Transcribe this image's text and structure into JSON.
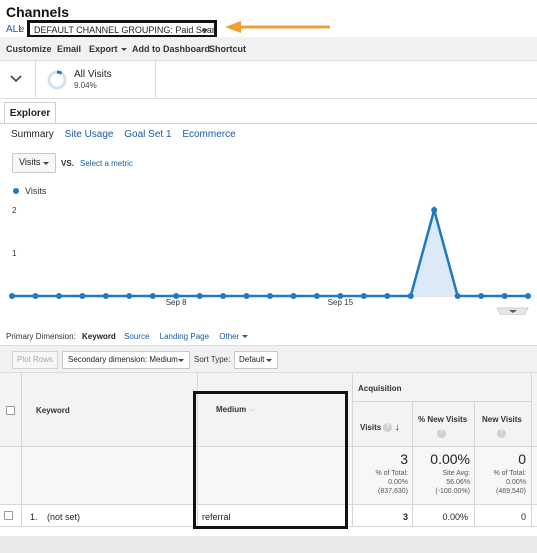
{
  "page": {
    "title": "Channels",
    "breadcrumb_all": "ALL",
    "breadcrumb_sep": "»",
    "grouping_label": "DEFAULT CHANNEL GROUPING: Paid Search"
  },
  "toolbar": {
    "customize": "Customize",
    "email": "Email",
    "export": "Export",
    "add_to_dashboard": "Add to Dashboard",
    "shortcut": "Shortcut"
  },
  "segment": {
    "name": "All Visits",
    "percent": "9.04%"
  },
  "tabs": {
    "explorer": "Explorer",
    "subtabs": [
      "Summary",
      "Site Usage",
      "Goal Set 1",
      "Ecommerce"
    ]
  },
  "metric": {
    "selected": "Visits",
    "vs": "VS.",
    "select_metric": "Select a metric"
  },
  "chart_data": {
    "type": "line",
    "series": [
      {
        "name": "Visits",
        "values": [
          0,
          0,
          0,
          0,
          0,
          0,
          0,
          0,
          0,
          0,
          0,
          0,
          0,
          0,
          0,
          0,
          0,
          0,
          2,
          0,
          0,
          0,
          0
        ]
      }
    ],
    "x_tick_labels": [
      "Sep 8",
      "Sep 15"
    ],
    "x_tick_index": [
      7,
      14
    ],
    "y_tick_labels": [
      "1",
      "2"
    ],
    "ylim": [
      0,
      2
    ],
    "color": "#1f78c1",
    "fill": "#dbeaf6",
    "legend": "top-left",
    "grid": false
  },
  "dimension": {
    "label": "Primary Dimension:",
    "current": "Keyword",
    "options": [
      "Source",
      "Landing Page",
      "Other"
    ]
  },
  "table_toolbar": {
    "plot_rows": "Plot Rows",
    "secondary": "Secondary dimension: Medium",
    "sort_label": "Sort Type:",
    "sort_value": "Default"
  },
  "table": {
    "group_header": "Acquisition",
    "col_keyword": "Keyword",
    "col_medium": "Medium",
    "col_visits": "Visits",
    "col_new_visits": "% New Visits",
    "col_new_visits_abbr": "New Visits",
    "totals": {
      "visits": "3",
      "visits_sub": [
        "% of Total:",
        "0.00%",
        "(837,630)"
      ],
      "pct_new": "0.00%",
      "pct_new_sub": [
        "Site Avg:",
        "56.06%",
        "(-100.00%)"
      ],
      "new_visits": "0",
      "new_visits_sub": [
        "% of Total:",
        "0.00%",
        "(469,540)"
      ]
    },
    "rows": [
      {
        "index": "1.",
        "keyword": "(not set)",
        "medium": "referral",
        "visits": "3",
        "pct_new": "0.00%",
        "new_visits": "0"
      }
    ]
  },
  "icons": {
    "collapse": "chevron-down-icon",
    "segment": "donut-icon",
    "sort": "sort-down-arrow-icon",
    "help": "question-icon",
    "annotation": "arrow-annotation-icon"
  },
  "colors": {
    "link": "#1a5ba6",
    "series": "#1f78c1",
    "arrow": "#f0a030"
  }
}
